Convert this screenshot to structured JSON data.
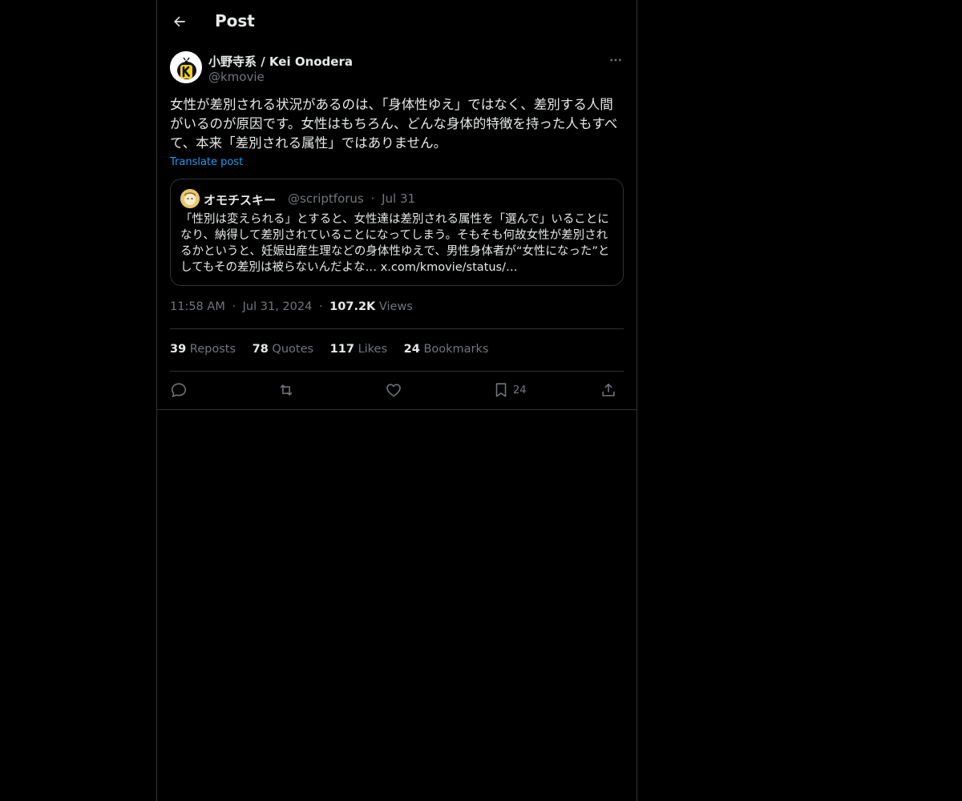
{
  "header": {
    "title": "Post"
  },
  "tweet": {
    "author_name": "小野寺系 / Kei Onodera",
    "author_handle": "@kmovie",
    "text": "女性が差別される状況があるのは、「身体性ゆえ」ではなく、差別する人間がいるのが原因です。女性はもちろん、どんな身体的特徴を持った人もすべて、本来「差別される属性」ではありません。",
    "translate_label": "Translate post",
    "time": "11:58 AM",
    "date": "Jul 31, 2024",
    "views_count": "107.2K",
    "views_label": "Views",
    "sep": "·"
  },
  "quote": {
    "author_name": "オモチスキー",
    "author_handle": "@scriptforus",
    "date": "Jul 31",
    "sep": "·",
    "text": "「性別は変えられる」とすると、女性達は差別される属性を「選んで」いることになり、納得して差別されていることになってしまう。そもそも何故女性が差別されるかというと、妊娠出産生理などの身体性ゆえで、男性身体者が“女性になった”としてもその差別は被らないんだよな… x.com/kmovie/status/…"
  },
  "stats": [
    {
      "count": "39",
      "label": "Reposts"
    },
    {
      "count": "78",
      "label": "Quotes"
    },
    {
      "count": "117",
      "label": "Likes"
    },
    {
      "count": "24",
      "label": "Bookmarks"
    }
  ],
  "actions": {
    "bookmark_count": "24",
    "icons": [
      "reply-icon",
      "repost-icon",
      "like-icon",
      "bookmark-icon",
      "share-icon"
    ]
  },
  "colors": {
    "background": "#000000",
    "text": "#e7e9ea",
    "muted": "#71767b",
    "link": "#1d9bf0",
    "border": "#2f3336"
  }
}
